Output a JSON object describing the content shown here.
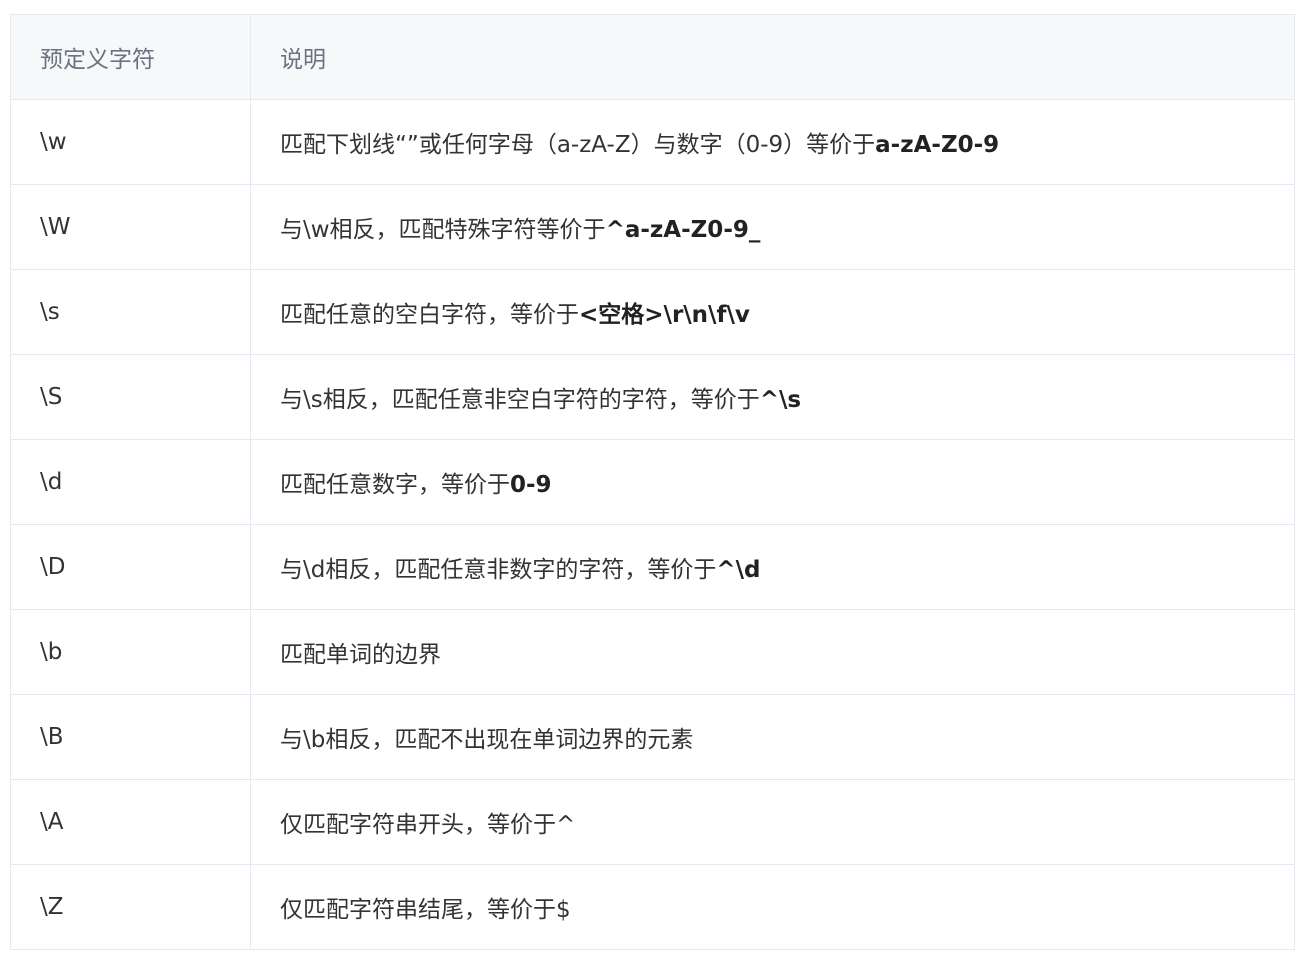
{
  "table": {
    "headers": [
      "预定义字符",
      "说明"
    ],
    "rows": [
      {
        "char": "\\w",
        "desc": "匹配下划线“”或任何字母（a-zA-Z）与数字（0-9）等价于",
        "bold": "a-zA-Z0-9"
      },
      {
        "char": "\\W",
        "desc": "与\\w相反，匹配特殊字符等价于",
        "bold": "^a-zA-Z0-9_"
      },
      {
        "char": "\\s",
        "desc": "匹配任意的空白字符，等价于",
        "bold": "<空格>\\r\\n\\f\\v"
      },
      {
        "char": "\\S",
        "desc": "与\\s相反，匹配任意非空白字符的字符，等价于",
        "bold": "^\\s"
      },
      {
        "char": "\\d",
        "desc": "匹配任意数字，等价于",
        "bold": "0-9"
      },
      {
        "char": "\\D",
        "desc": "与\\d相反，匹配任意非数字的字符，等价于",
        "bold": "^\\d"
      },
      {
        "char": "\\b",
        "desc": "匹配单词的边界",
        "bold": ""
      },
      {
        "char": "\\B",
        "desc": "与\\b相反，匹配不出现在单词边界的元素",
        "bold": ""
      },
      {
        "char": "\\A",
        "desc": "仅匹配字符串开头，等价于^",
        "bold": ""
      },
      {
        "char": "\\Z",
        "desc": "仅匹配字符串结尾，等价于$",
        "bold": ""
      }
    ]
  }
}
